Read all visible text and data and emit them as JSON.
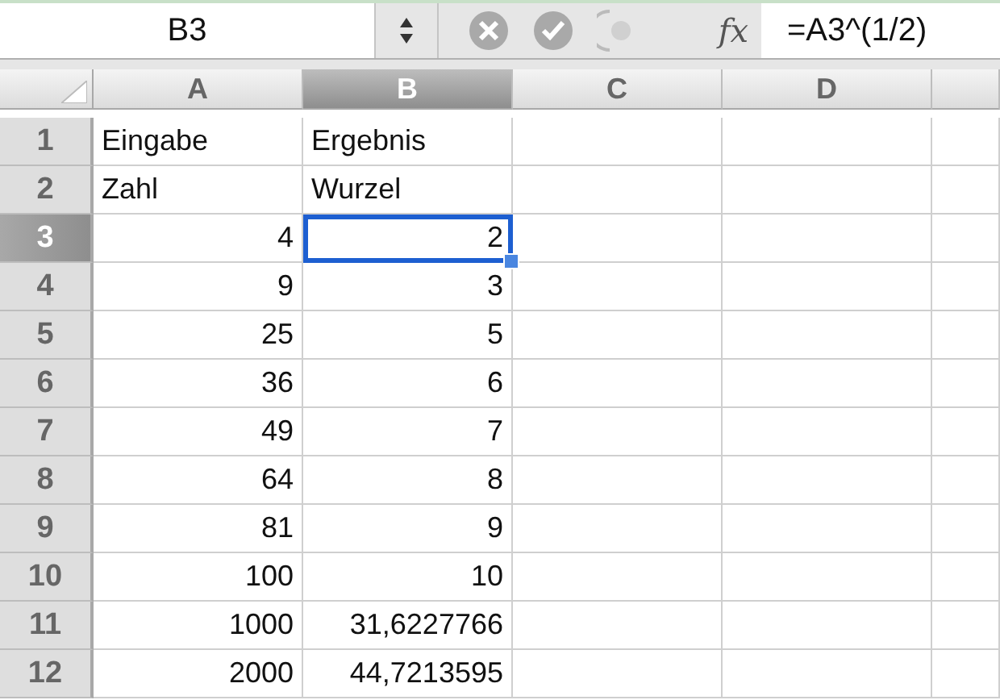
{
  "formula_bar": {
    "name_box": "B3",
    "fx_label": "fx",
    "formula": "=A3^(1/2)"
  },
  "columns": [
    {
      "label": "A",
      "selected": false
    },
    {
      "label": "B",
      "selected": true
    },
    {
      "label": "C",
      "selected": false
    },
    {
      "label": "D",
      "selected": false
    }
  ],
  "rows": [
    {
      "label": "1",
      "selected": false,
      "cells": [
        {
          "value": "Eingabe",
          "kind": "text",
          "selected": false
        },
        {
          "value": "Ergebnis",
          "kind": "text",
          "selected": false
        }
      ]
    },
    {
      "label": "2",
      "selected": false,
      "cells": [
        {
          "value": "Zahl",
          "kind": "text",
          "selected": false
        },
        {
          "value": "Wurzel",
          "kind": "text",
          "selected": false
        }
      ]
    },
    {
      "label": "3",
      "selected": true,
      "cells": [
        {
          "value": "4",
          "kind": "number",
          "selected": false
        },
        {
          "value": "2",
          "kind": "number",
          "selected": true
        }
      ]
    },
    {
      "label": "4",
      "selected": false,
      "cells": [
        {
          "value": "9",
          "kind": "number",
          "selected": false
        },
        {
          "value": "3",
          "kind": "number",
          "selected": false
        }
      ]
    },
    {
      "label": "5",
      "selected": false,
      "cells": [
        {
          "value": "25",
          "kind": "number",
          "selected": false
        },
        {
          "value": "5",
          "kind": "number",
          "selected": false
        }
      ]
    },
    {
      "label": "6",
      "selected": false,
      "cells": [
        {
          "value": "36",
          "kind": "number",
          "selected": false
        },
        {
          "value": "6",
          "kind": "number",
          "selected": false
        }
      ]
    },
    {
      "label": "7",
      "selected": false,
      "cells": [
        {
          "value": "49",
          "kind": "number",
          "selected": false
        },
        {
          "value": "7",
          "kind": "number",
          "selected": false
        }
      ]
    },
    {
      "label": "8",
      "selected": false,
      "cells": [
        {
          "value": "64",
          "kind": "number",
          "selected": false
        },
        {
          "value": "8",
          "kind": "number",
          "selected": false
        }
      ]
    },
    {
      "label": "9",
      "selected": false,
      "cells": [
        {
          "value": "81",
          "kind": "number",
          "selected": false
        },
        {
          "value": "9",
          "kind": "number",
          "selected": false
        }
      ]
    },
    {
      "label": "10",
      "selected": false,
      "cells": [
        {
          "value": "100",
          "kind": "number",
          "selected": false
        },
        {
          "value": "10",
          "kind": "number",
          "selected": false
        }
      ]
    },
    {
      "label": "11",
      "selected": false,
      "cells": [
        {
          "value": "1000",
          "kind": "number",
          "selected": false
        },
        {
          "value": "31,6227766",
          "kind": "number",
          "selected": false
        }
      ]
    },
    {
      "label": "12",
      "selected": false,
      "cells": [
        {
          "value": "2000",
          "kind": "number",
          "selected": false
        },
        {
          "value": "44,7213595",
          "kind": "number",
          "selected": false
        }
      ]
    }
  ]
}
